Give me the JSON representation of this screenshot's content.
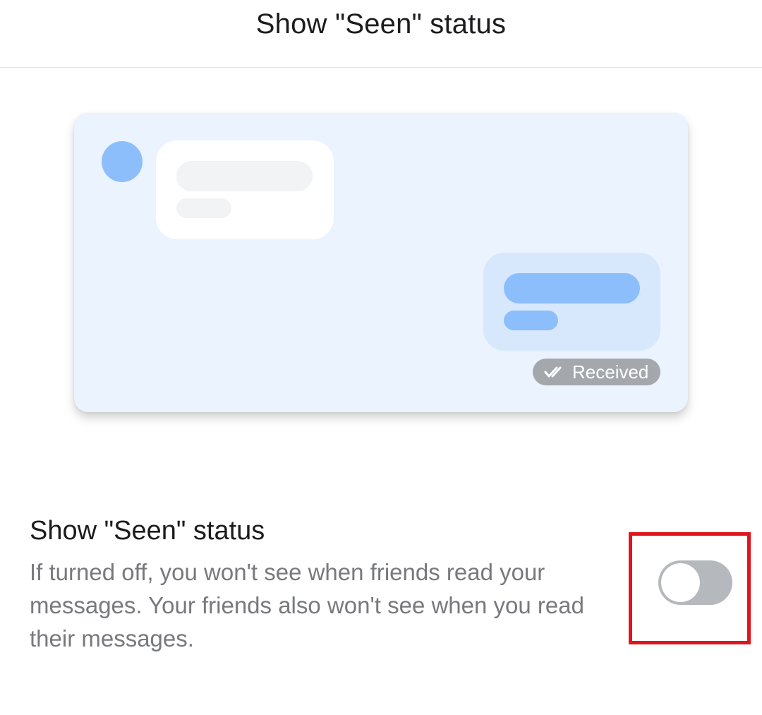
{
  "header": {
    "title": "Show \"Seen\" status"
  },
  "illustration": {
    "badge_label": "Received",
    "badge_icon": "double-check-icon",
    "colors": {
      "background": "#eaf3fe",
      "avatar": "#8dbefc",
      "outgoing_bubble": "#d7e8fd",
      "badge": "#a4a7ab"
    }
  },
  "setting": {
    "title": "Show \"Seen\" status",
    "description": "If turned off, you won't see when friends read your messages. Your friends also won't see when you read their messages.",
    "toggle_on": false,
    "highlight_color": "#e0141e"
  }
}
